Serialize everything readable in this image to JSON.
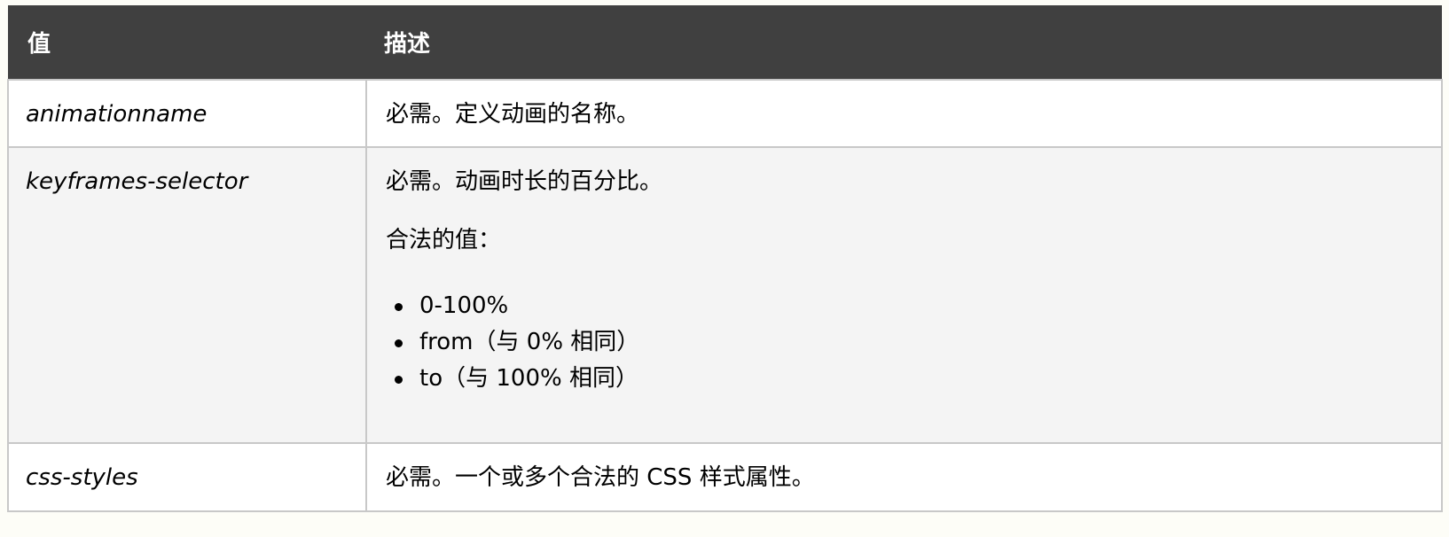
{
  "table": {
    "headers": [
      "值",
      "描述"
    ],
    "rows": [
      {
        "value": "animationname",
        "description": "必需。定义动画的名称。"
      },
      {
        "value": "keyframes-selector",
        "description": "必需。动画时长的百分比。",
        "legal_values_label": "合法的值：",
        "legal_values": [
          "0-100%",
          "from（与 0% 相同）",
          "to（与 100% 相同）"
        ]
      },
      {
        "value": "css-styles",
        "description": "必需。一个或多个合法的 CSS 样式属性。"
      }
    ]
  },
  "colors": {
    "header_bg": "#404040",
    "header_text": "#ffffff",
    "alt_row_bg": "#f4f4f4",
    "border": "#c8c8c8"
  }
}
